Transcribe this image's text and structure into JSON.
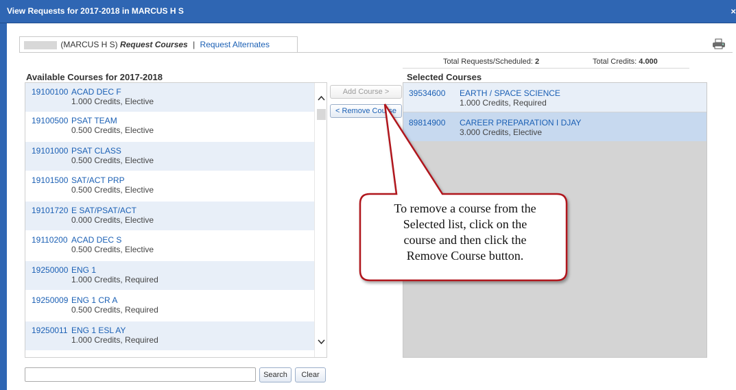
{
  "window": {
    "title": "View Requests for 2017-2018 in MARCUS H S",
    "close_glyph": "×"
  },
  "tabs": {
    "student_label": "(MARCUS H S)",
    "request_courses": "Request Courses",
    "separator": "|",
    "request_alternates": "Request Alternates"
  },
  "totals": {
    "requests_label": "Total Requests/Scheduled:",
    "requests_value": "2",
    "credits_label": "Total Credits:",
    "credits_value": "4.000"
  },
  "available": {
    "heading": "Available Courses for 2017-2018",
    "courses": [
      {
        "code": "19100100",
        "name": "ACAD DEC F",
        "meta": "1.000 Credits,  Elective"
      },
      {
        "code": "19100500",
        "name": "PSAT TEAM",
        "meta": "0.500 Credits,  Elective"
      },
      {
        "code": "19101000",
        "name": "PSAT CLASS",
        "meta": "0.500 Credits,  Elective"
      },
      {
        "code": "19101500",
        "name": "SAT/ACT PRP",
        "meta": "0.500 Credits,  Elective"
      },
      {
        "code": "19101720",
        "name": "E SAT/PSAT/ACT",
        "meta": "0.000 Credits,  Elective"
      },
      {
        "code": "19110200",
        "name": "ACAD DEC S",
        "meta": "0.500 Credits,  Elective"
      },
      {
        "code": "19250000",
        "name": "ENG 1",
        "meta": "1.000 Credits,  Required"
      },
      {
        "code": "19250009",
        "name": "ENG 1 CR A",
        "meta": "0.500 Credits,  Required"
      },
      {
        "code": "19250011",
        "name": "ENG 1 ESL AY",
        "meta": "1.000 Credits,  Required"
      }
    ]
  },
  "buttons": {
    "add_course": "Add Course >",
    "remove_course": "< Remove Course",
    "search": "Search",
    "clear": "Clear"
  },
  "selected": {
    "heading": "Selected Courses",
    "courses": [
      {
        "code": "39534600",
        "name": "EARTH / SPACE SCIENCE",
        "meta": "1.000 Credits,  Required"
      },
      {
        "code": "89814900",
        "name": "CAREER PREPARATION I DJAY",
        "meta": "3.000 Credits,  Elective"
      }
    ]
  },
  "search": {
    "value": "",
    "placeholder": ""
  },
  "callout": {
    "line1": "To remove a course from the",
    "line2": "Selected list, click on the",
    "line3": "course and then click the",
    "line4": "Remove Course button."
  },
  "colors": {
    "titlebar": "#2f66b3",
    "link": "#1a5fb4",
    "callout_border": "#b0121b",
    "selected_row": "#c7d9ef"
  }
}
